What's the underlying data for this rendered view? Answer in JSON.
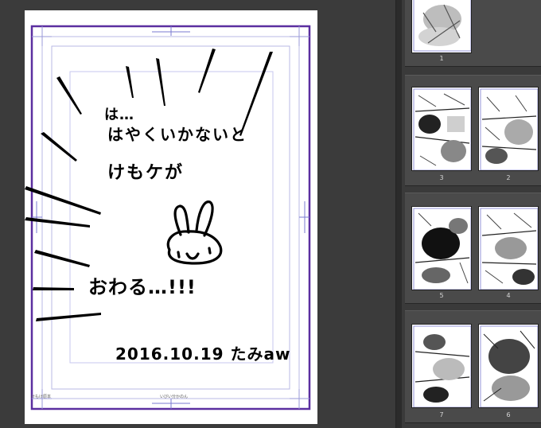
{
  "canvas": {
    "lines": [
      {
        "text": "は…"
      },
      {
        "text": "はやくいかないと"
      },
      {
        "text": "けもケが"
      },
      {
        "text": "おわる…!!!"
      },
      {
        "text": "2016.10.19 たみaw"
      }
    ],
    "footer_left": "けもけ原本",
    "footer_center": "いびい分かのん"
  },
  "pages_panel": {
    "spreads": [
      {
        "pages": [
          {
            "label": "1"
          }
        ]
      },
      {
        "pages": [
          {
            "label": "3"
          },
          {
            "label": "2"
          }
        ]
      },
      {
        "pages": [
          {
            "label": "5"
          },
          {
            "label": "4"
          }
        ]
      },
      {
        "pages": [
          {
            "label": "7"
          },
          {
            "label": "6"
          }
        ]
      }
    ]
  },
  "colors": {
    "workspace": "#3b3b3b",
    "panel": "#3a3a3a",
    "spread_bg": "#4a4a4a",
    "frame_purple": "#5b2fa0",
    "guide_blue": "#7a7ad0"
  }
}
